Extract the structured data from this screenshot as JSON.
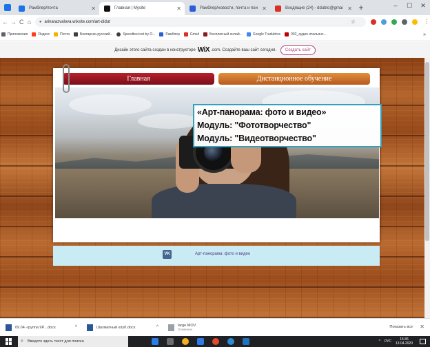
{
  "browser": {
    "tabs": [
      {
        "title": "Рамблер/почта",
        "favicon_color": "#1a73e8",
        "active": false
      },
      {
        "title": "Главная | Mysite",
        "favicon_color": "#111111",
        "active": true
      },
      {
        "title": "Рамблер/новости, почта и пои",
        "favicon_color": "#2b5fd9",
        "active": false
      },
      {
        "title": "Входящие (24) - ddubto@gmai",
        "favicon_color": "#d93025",
        "active": false
      }
    ],
    "new_tab": "+",
    "window_controls": [
      "–",
      "☐",
      "✕"
    ],
    "nav": {
      "back": "←",
      "forward": "→",
      "reload": "C",
      "home": "⌂"
    },
    "url": "arinarazvalova.wixsite.com/art-didut",
    "star": "☆",
    "extension_colors": [
      "#d93025",
      "#4f9edb",
      "#34a853",
      "#5f6368",
      "#fbbc04"
    ],
    "menu": "⋮",
    "bookmarks": [
      {
        "label": "Приложения",
        "color": "#5f6368"
      },
      {
        "label": "Яндекс",
        "color": "#fc3f1d"
      },
      {
        "label": "Почта",
        "color": "#f4b400"
      },
      {
        "label": "Болгарско-русский...",
        "color": "#3c4043"
      },
      {
        "label": "Speedtest.net by O...",
        "color": "#3c4043"
      },
      {
        "label": "Рамблер",
        "color": "#2b5fd9"
      },
      {
        "label": "Gmail",
        "color": "#d93025"
      },
      {
        "label": "Бесплатный онлай...",
        "color": "#8a1c1c"
      },
      {
        "label": "Google Traduttore",
        "color": "#4285f4"
      },
      {
        "label": "002_аудио итальянс...",
        "color": "#c00000"
      }
    ],
    "bookmarks_more": "»"
  },
  "wix_banner": {
    "text_before": "Дизайн этого сайта создан в конструкторе",
    "brand": "WiX",
    "text_after": ".com. Создайте ваш сайт сегодня.",
    "button": "Создать сайт"
  },
  "site": {
    "nav": [
      {
        "label": "Главная"
      },
      {
        "label": "Дистанционное обучение"
      }
    ],
    "headline": [
      "«Арт-панорама: фото и видео»",
      "Модуль: \"Фототворчество\"",
      "Модуль: \"Видеотворчество\""
    ],
    "footer": {
      "vk_icon": "VK",
      "link": "Арт-панорама: фото и видео"
    },
    "colors": {
      "home_button": "#9a1522",
      "distance_button": "#cf7430",
      "headline_border": "#36a0b8",
      "footer_bg": "#c9ebf4"
    }
  },
  "downloads": {
    "items": [
      {
        "name": "09.04.-группа 9Р....docx",
        "sub": ""
      },
      {
        "name": "Шахматный клуб.docx",
        "sub": ""
      },
      {
        "name": "large.MOV",
        "sub": "Отменено"
      }
    ],
    "show_all": "Показать все",
    "close": "✕"
  },
  "taskbar": {
    "search_placeholder": "Введите здесь текст для поиска",
    "app_colors": [
      "#2b7de9",
      "#6b6b6b",
      "#f2b21b",
      "#2b7de9",
      "#e34c26",
      "#2b8cd6",
      "#1e73be"
    ],
    "language": "РУС",
    "time": "15:36",
    "date": "13.04.2020"
  }
}
